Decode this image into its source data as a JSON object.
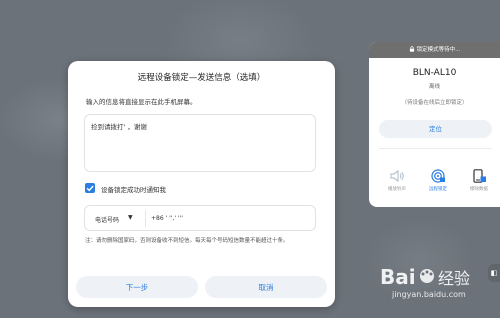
{
  "dialog": {
    "title": "远程设备锁定—发送信息（选填）",
    "description": "输入的信息将直接显示在此手机屏幕。",
    "message_value": "捡到请拨打'                           ，谢谢",
    "notify_label": "设备锁定成功时通知我",
    "phone_type": "电话号码",
    "phone_value": "+86 ' '',' '''",
    "note": "注：请勿删除国家码，否则设备收不到短信。每天每个号码短信数量不能超过十条。",
    "next_label": "下一步",
    "cancel_label": "取消"
  },
  "panel": {
    "header": "锁定模式等待中...",
    "device_name": "BLN-AL10",
    "device_status": "离线",
    "device_note": "（待设备在线后立即锁定）",
    "locate_label": "定位",
    "actions": [
      {
        "label": "播放铃声",
        "icon": "speaker-icon"
      },
      {
        "label": "远程锁定",
        "icon": "remote-lock-icon"
      },
      {
        "label": "擦除数据",
        "icon": "erase-phone-icon"
      }
    ]
  },
  "colors": {
    "accent": "#2a7de1",
    "overlay": "#6b7279",
    "header_gray": "#6f6f6f"
  },
  "watermark": {
    "text": "Bai 经验",
    "url": "jingyan.baidu.com"
  }
}
